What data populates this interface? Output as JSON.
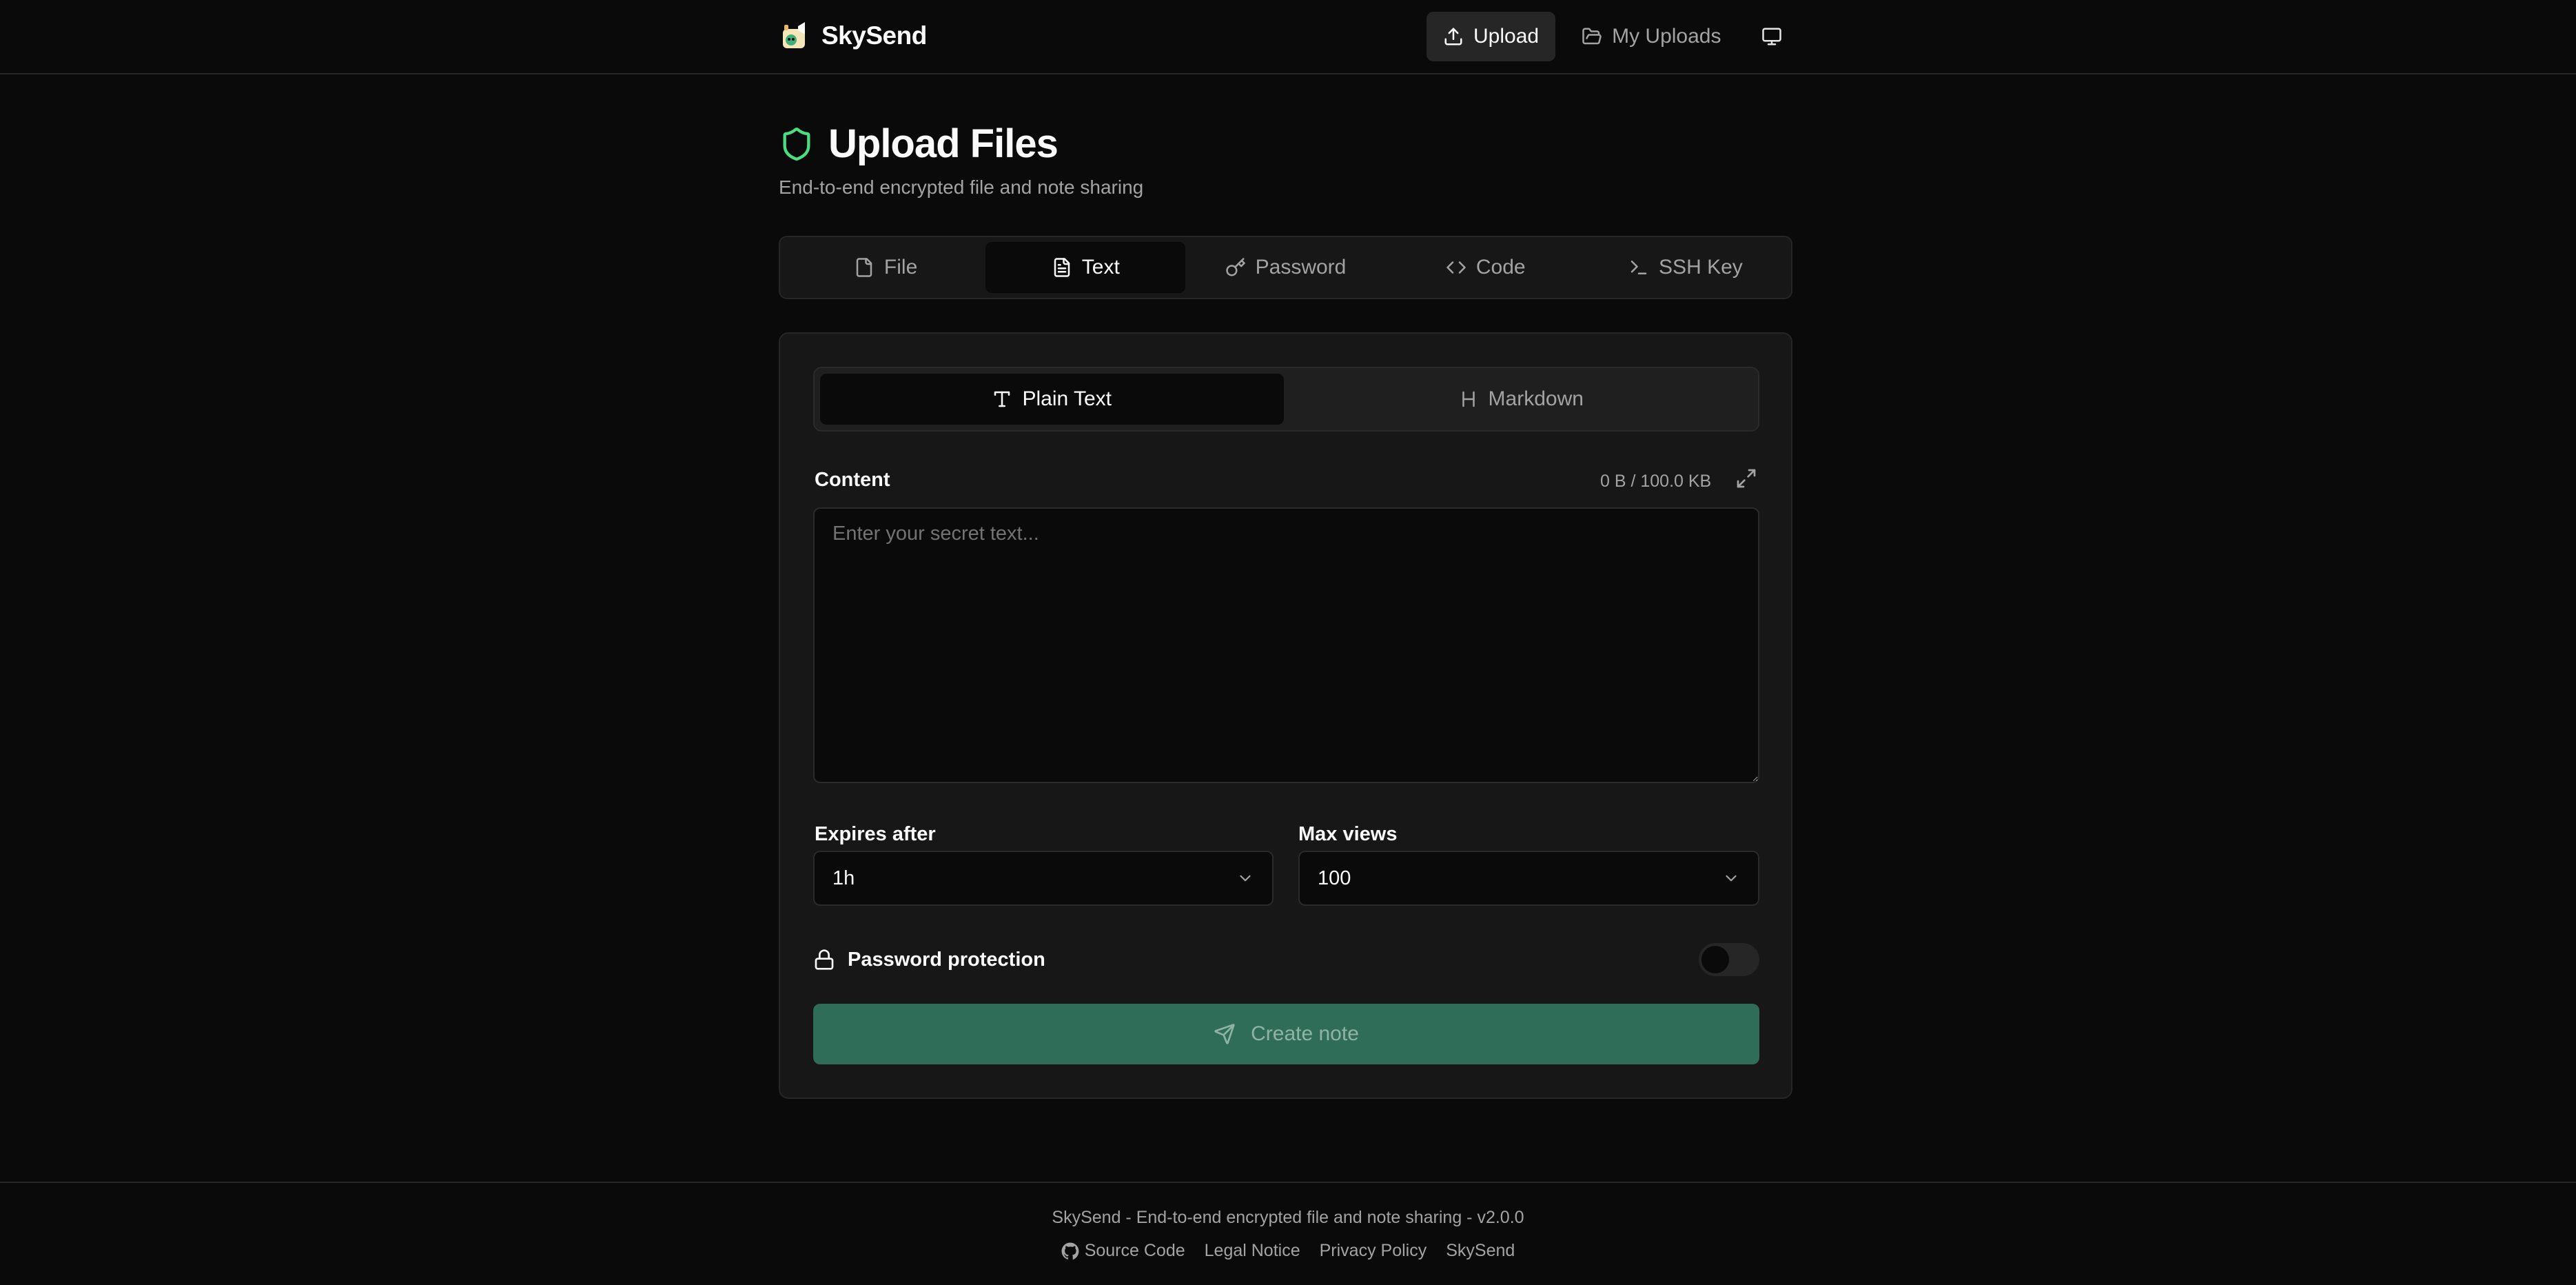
{
  "header": {
    "brand_name": "SkySend",
    "nav": {
      "upload_label": "Upload",
      "my_uploads_label": "My Uploads"
    }
  },
  "page": {
    "title": "Upload Files",
    "subtitle": "End-to-end encrypted file and note sharing"
  },
  "tabs": [
    {
      "label": "File",
      "icon": "file-icon"
    },
    {
      "label": "Text",
      "icon": "file-text-icon",
      "active": true
    },
    {
      "label": "Password",
      "icon": "key-icon"
    },
    {
      "label": "Code",
      "icon": "code-icon"
    },
    {
      "label": "SSH Key",
      "icon": "terminal-icon"
    }
  ],
  "form": {
    "modes": {
      "plain_text_label": "Plain Text",
      "markdown_label": "Markdown"
    },
    "content_label": "Content",
    "size_counter": "0 B / 100.0 KB",
    "textarea_placeholder": "Enter your secret text...",
    "textarea_value": "",
    "expires_label": "Expires after",
    "expires_value": "1h",
    "max_views_label": "Max views",
    "max_views_value": "100",
    "password_protection_label": "Password protection",
    "password_protection_enabled": false,
    "create_label": "Create note"
  },
  "footer": {
    "tagline": "SkySend - End-to-end encrypted file and note sharing - v2.0.0",
    "links": {
      "source_code": "Source Code",
      "legal_notice": "Legal Notice",
      "privacy_policy": "Privacy Policy",
      "skysend": "SkySend"
    }
  },
  "colors": {
    "background": "#0a0a0a",
    "card": "#171717",
    "border": "#262626",
    "accent_green": "#2f6d58",
    "shield_green": "#4ade80"
  }
}
